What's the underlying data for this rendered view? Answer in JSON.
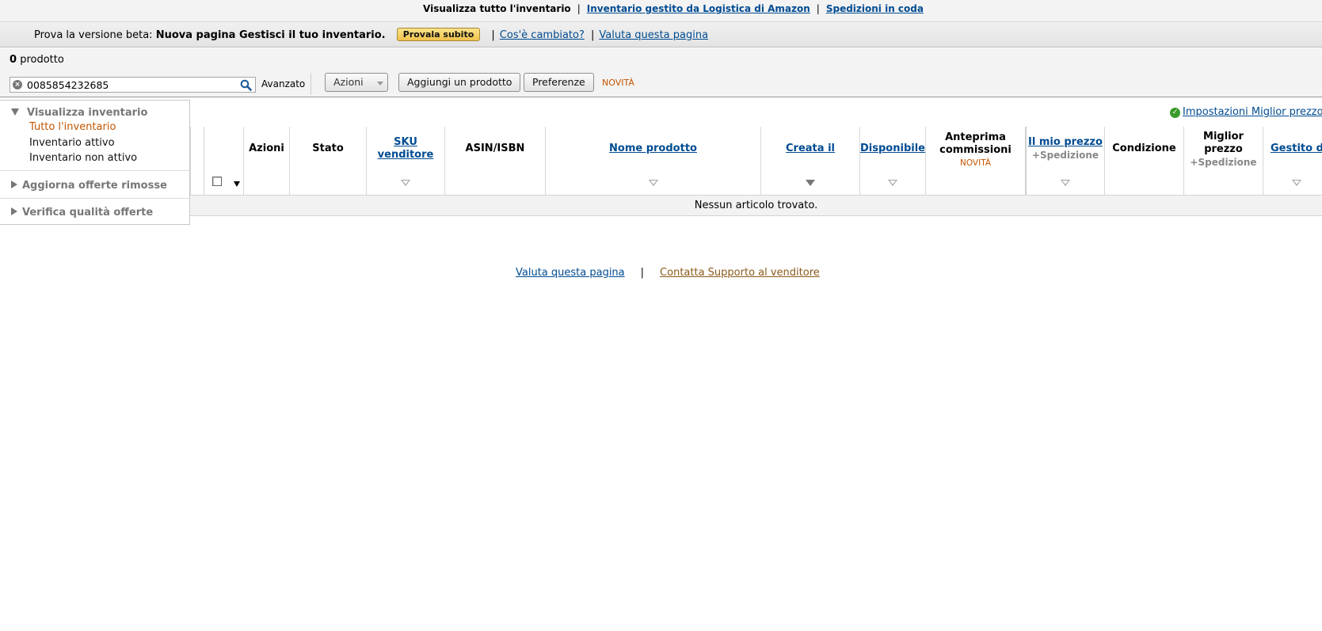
{
  "topnav": {
    "current": "Visualizza tutto l'inventario",
    "link_fba": "Inventario gestito da Logistica di Amazon",
    "link_queue": "Spedizioni in coda",
    "separator": "|"
  },
  "beta": {
    "prefix": "Prova la versione beta:",
    "title": "Nuova pagina Gestisci il tuo inventario.",
    "button": "Provala subito",
    "separator": "|",
    "link_changes": "Cos'è cambiato?",
    "link_rate": "Valuta questa pagina"
  },
  "toolbar": {
    "count_number": "0",
    "count_label": "prodotto",
    "search_value": "0085854232685",
    "advanced": "Avanzato",
    "actions": "Azioni",
    "add_product": "Aggiungi un prodotto",
    "preferences": "Preferenze",
    "new_badge": "NOVITÀ"
  },
  "sidebar": {
    "heading": "Visualizza inventario",
    "items": [
      {
        "label": "Tutto l'inventario",
        "active": true
      },
      {
        "label": "Inventario attivo",
        "active": false
      },
      {
        "label": "Inventario non attivo",
        "active": false
      }
    ],
    "section2": "Aggiorna offerte rimosse",
    "section3": "Verifica qualità offerte"
  },
  "settings_link": "Impostazioni Miglior prezzo",
  "table": {
    "columns": {
      "azioni": "Azioni",
      "stato": "Stato",
      "sku_1": "SKU",
      "sku_2": "venditore",
      "asin": "ASIN/ISBN",
      "nome": "Nome prodotto",
      "creata": "Creata il",
      "disponibile": "Disponibile",
      "anteprima_1": "Anteprima",
      "anteprima_2": "commissioni",
      "anteprima_badge": "NOVITÀ",
      "mio_prezzo": "Il mio prezzo",
      "mio_prezzo_sub": "+Spedizione",
      "condizione": "Condizione",
      "miglior_1": "Miglior",
      "miglior_2": "prezzo",
      "miglior_sub": "+Spedizione",
      "gestito": "Gestito da"
    },
    "empty_message": "Nessun articolo trovato."
  },
  "footer": {
    "rate": "Valuta questa pagina",
    "separator": "|",
    "support": "Contatta Supporto al venditore"
  },
  "colors": {
    "link": "#004b91",
    "accent_orange": "#c45500",
    "button_gold": "#f0c14b",
    "success_green": "#3a9a2a"
  }
}
